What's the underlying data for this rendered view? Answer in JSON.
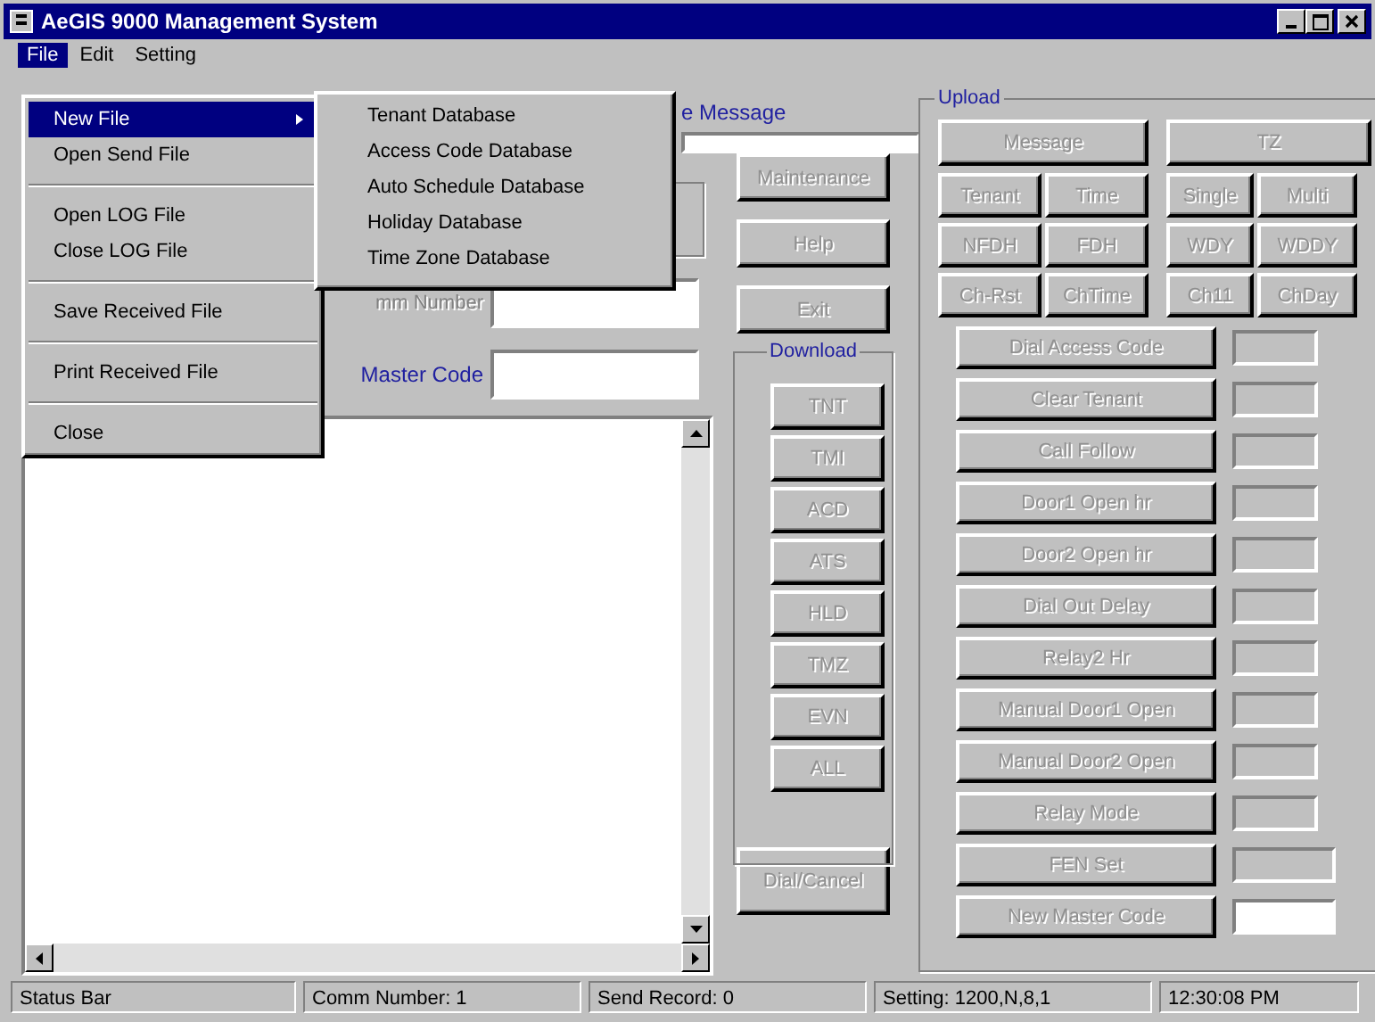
{
  "window": {
    "title": "AeGIS 9000 Management System"
  },
  "menu_bar": [
    {
      "label": "File",
      "selected": true
    },
    {
      "label": "Edit",
      "selected": false
    },
    {
      "label": "Setting",
      "selected": false
    }
  ],
  "file_menu": [
    {
      "kind": "item",
      "label": "New File",
      "selected": true,
      "submenu": true
    },
    {
      "kind": "item",
      "label": "Open Send File",
      "selected": false,
      "submenu": false
    },
    {
      "kind": "separator"
    },
    {
      "kind": "item",
      "label": "Open LOG File",
      "selected": false,
      "submenu": false
    },
    {
      "kind": "item",
      "label": "Close LOG File",
      "selected": false,
      "submenu": false
    },
    {
      "kind": "separator"
    },
    {
      "kind": "item",
      "label": "Save Received File",
      "selected": false,
      "submenu": false
    },
    {
      "kind": "separator"
    },
    {
      "kind": "item",
      "label": "Print Received File",
      "selected": false,
      "submenu": false
    },
    {
      "kind": "separator"
    },
    {
      "kind": "item",
      "label": "Close",
      "selected": false,
      "submenu": false
    }
  ],
  "new_file_submenu": [
    "Tenant Database",
    "Access Code Database",
    "Auto Schedule Database",
    "Holiday Database",
    "Time Zone Database"
  ],
  "message": {
    "label": "e Message"
  },
  "comm_number": {
    "label": "mm Number",
    "disabled": true
  },
  "master_code": {
    "label": "Master Code",
    "disabled": false
  },
  "side_buttons": [
    {
      "label": "Maintenance",
      "disabled": true
    },
    {
      "label": "Help",
      "disabled": true
    },
    {
      "label": "Exit",
      "disabled": true
    }
  ],
  "download": {
    "title": "Download",
    "buttons": [
      {
        "label": "TNT",
        "disabled": true
      },
      {
        "label": "TMI",
        "disabled": true
      },
      {
        "label": "ACD",
        "disabled": true
      },
      {
        "label": "ATS",
        "disabled": true
      },
      {
        "label": "HLD",
        "disabled": true
      },
      {
        "label": "TMZ",
        "disabled": true
      },
      {
        "label": "EVN",
        "disabled": true
      },
      {
        "label": "ALL",
        "disabled": true
      }
    ]
  },
  "dial_button": {
    "label": "Dial/Cancel",
    "disabled": true
  },
  "upload": {
    "title": "Upload",
    "top_buttons": [
      {
        "label": "Message",
        "disabled": true
      },
      {
        "label": "TZ",
        "disabled": true
      }
    ],
    "grid_buttons": [
      {
        "label": "Tenant",
        "disabled": true
      },
      {
        "label": "Time",
        "disabled": true
      },
      {
        "label": "Single",
        "disabled": true
      },
      {
        "label": "Multi",
        "disabled": true
      },
      {
        "label": "NFDH",
        "disabled": true
      },
      {
        "label": "FDH",
        "disabled": true
      },
      {
        "label": "WDY",
        "disabled": true
      },
      {
        "label": "WDDY",
        "disabled": true
      },
      {
        "label": "Ch-Rst",
        "disabled": true
      },
      {
        "label": "ChTime",
        "disabled": true
      },
      {
        "label": "Ch11",
        "disabled": true
      },
      {
        "label": "ChDay",
        "disabled": true
      }
    ],
    "rows": [
      {
        "label": "Dial Access Code",
        "disabled": true,
        "field_disabled": true
      },
      {
        "label": "Clear Tenant",
        "disabled": true,
        "field_disabled": true
      },
      {
        "label": "Call Follow",
        "disabled": true,
        "field_disabled": true
      },
      {
        "label": "Door1 Open hr",
        "disabled": true,
        "field_disabled": true
      },
      {
        "label": "Door2 Open hr",
        "disabled": true,
        "field_disabled": true
      },
      {
        "label": "Dial Out Delay",
        "disabled": true,
        "field_disabled": true
      },
      {
        "label": "Relay2 Hr",
        "disabled": true,
        "field_disabled": true
      },
      {
        "label": "Manual Door1 Open",
        "disabled": true,
        "field_disabled": true
      },
      {
        "label": "Manual Door2 Open",
        "disabled": true,
        "field_disabled": true
      },
      {
        "label": "Relay Mode",
        "disabled": true,
        "field_disabled": true
      },
      {
        "label": "FEN Set",
        "disabled": true,
        "field_disabled": true
      },
      {
        "label": "New Master Code",
        "disabled": true,
        "field_disabled": false
      }
    ]
  },
  "status_bar": [
    "Status Bar",
    "Comm Number: 1",
    "Send Record: 0",
    "Setting: 1200,N,8,1",
    "12:30:08 PM"
  ]
}
